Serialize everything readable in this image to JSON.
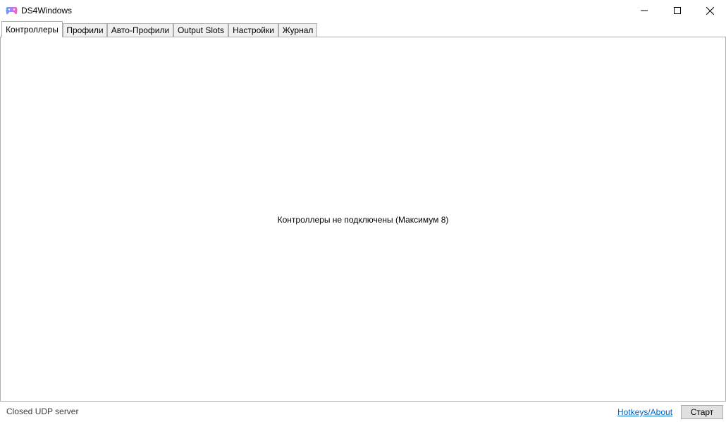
{
  "window": {
    "title": "DS4Windows",
    "icon": "gamepad-icon",
    "controls": [
      "minimize-icon",
      "maximize-icon",
      "close-icon"
    ]
  },
  "tabs": [
    {
      "label": "Контроллеры",
      "active": true
    },
    {
      "label": "Профили",
      "active": false
    },
    {
      "label": "Авто-Профили",
      "active": false
    },
    {
      "label": "Output Slots",
      "active": false
    },
    {
      "label": "Настройки",
      "active": false
    },
    {
      "label": "Журнал",
      "active": false
    }
  ],
  "controllers_panel": {
    "empty_message": "Контроллеры не подключены (Максимум 8)"
  },
  "status_bar": {
    "status_text": "Closed UDP server",
    "hotkeys_link": "Hotkeys/About",
    "start_button": "Старт"
  }
}
